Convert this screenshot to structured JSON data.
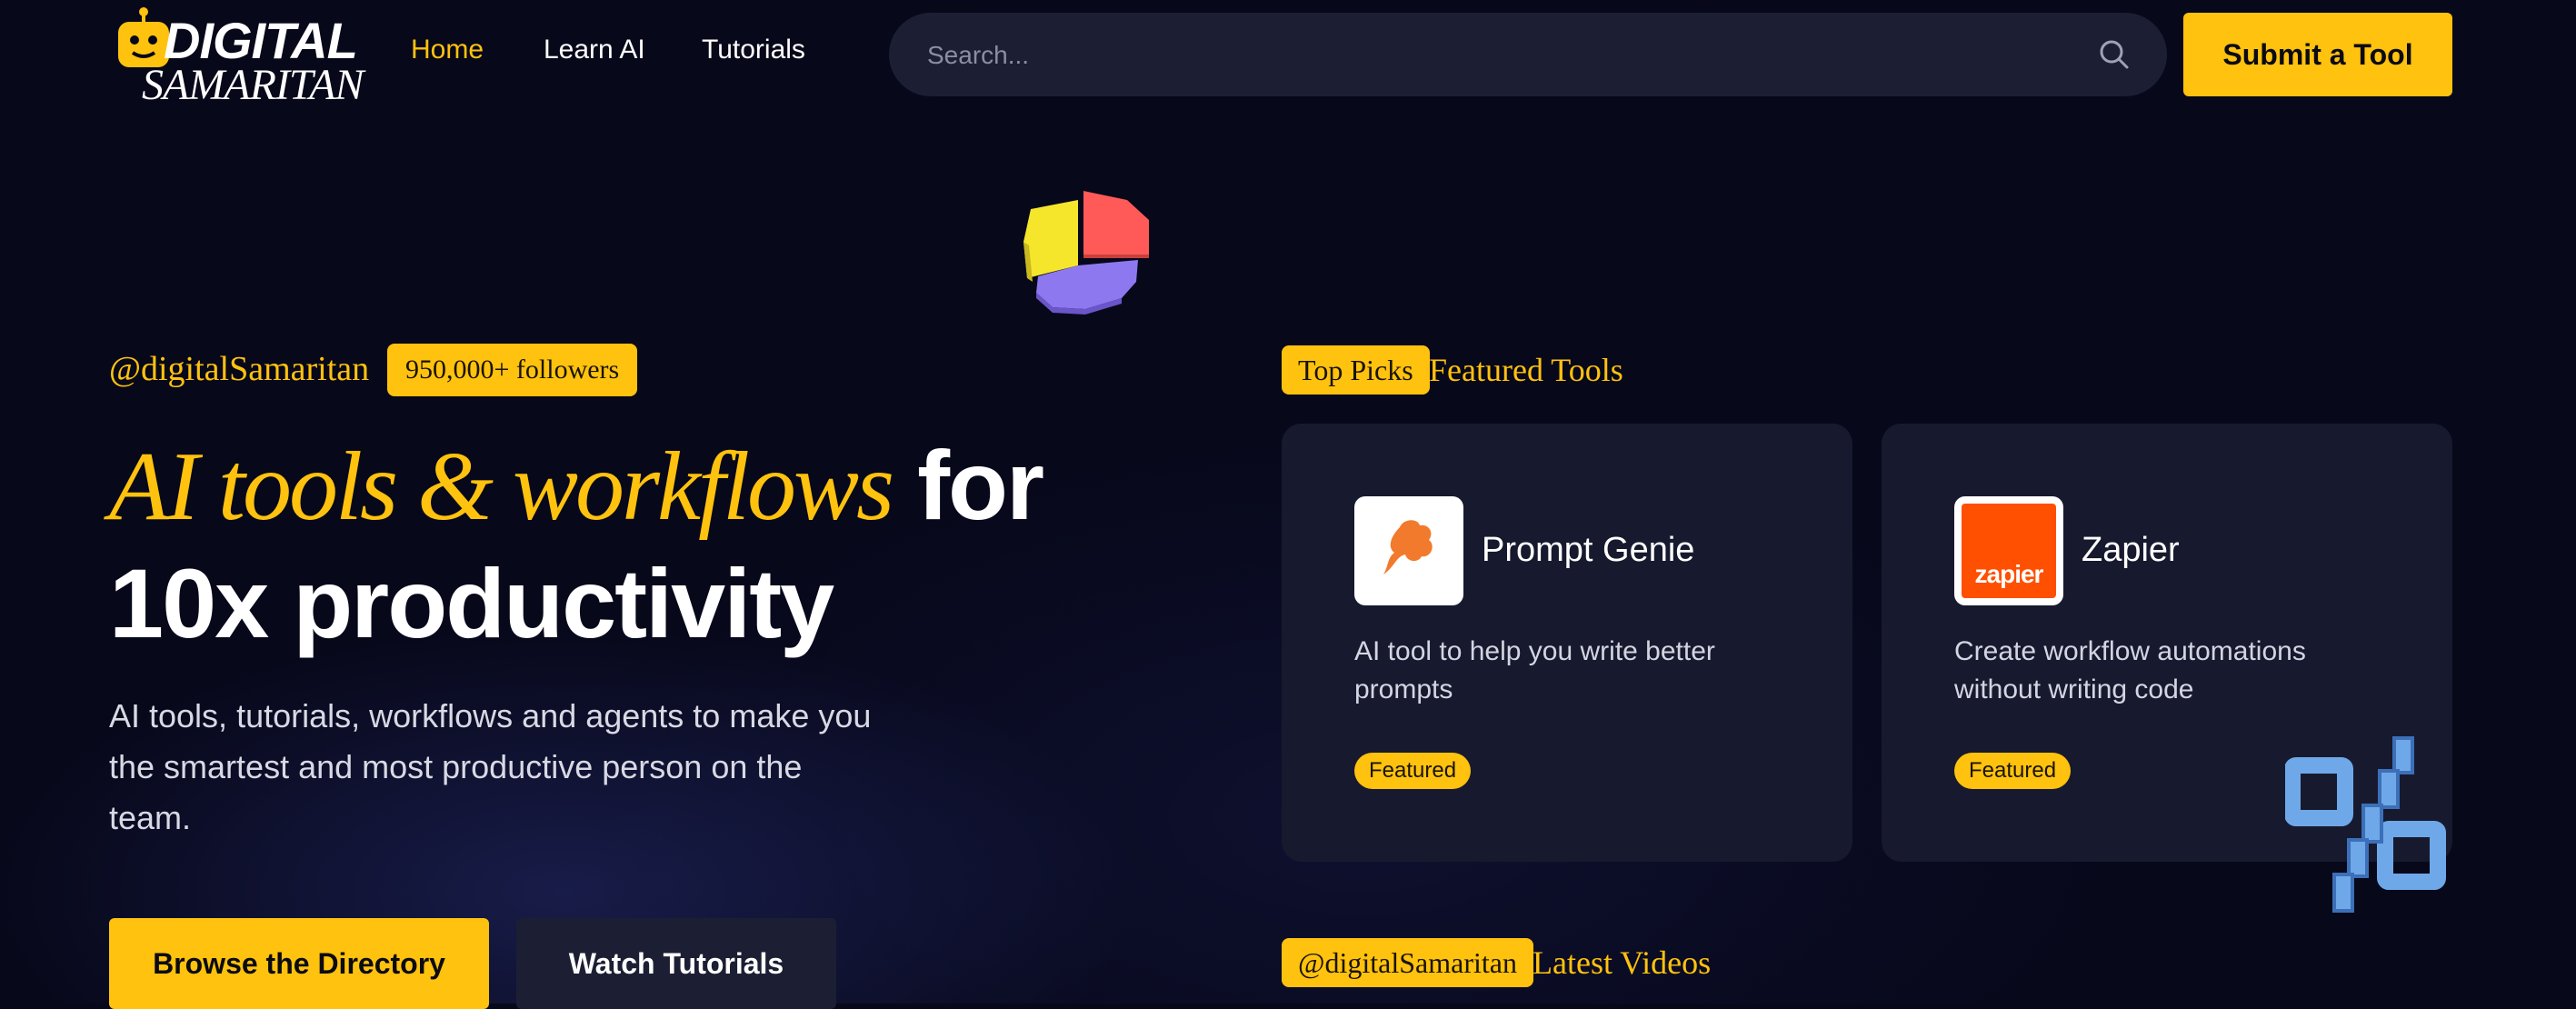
{
  "header": {
    "logo_line1": "DIGITAL",
    "logo_line2": "SAMARITAN",
    "nav": [
      {
        "label": "Home",
        "active": true
      },
      {
        "label": "Learn AI",
        "active": false
      },
      {
        "label": "Tutorials",
        "active": false
      }
    ],
    "search_placeholder": "Search...",
    "submit_label": "Submit a Tool"
  },
  "hero": {
    "handle": "@digitalSamaritan",
    "followers_badge": "950,000+ followers",
    "headline_accent": "AI tools & workflows",
    "headline_rest_1": " for",
    "headline_rest_2": "10x productivity",
    "subtext": "AI tools, tutorials, workflows and agents to make you the smartest and most productive person on the team.",
    "browse_label": "Browse the Directory",
    "watch_label": "Watch Tutorials"
  },
  "featured": {
    "pill": "Top Picks",
    "label": "Featured Tools",
    "tools": [
      {
        "name": "Prompt Genie",
        "description": "AI tool to help you write better prompts",
        "badge": "Featured",
        "icon": "prompt-genie-logo"
      },
      {
        "name": "Zapier",
        "description": "Create workflow automations without writing code",
        "badge": "Featured",
        "icon": "zapier-logo",
        "logo_text": "zapier"
      }
    ]
  },
  "videos": {
    "pill": "@digitalSamaritan",
    "label": "Latest Videos"
  },
  "colors": {
    "background": "#07081a",
    "accent": "#ffc20e",
    "card": "#171a2e",
    "zapier_orange": "#ff4f00"
  }
}
